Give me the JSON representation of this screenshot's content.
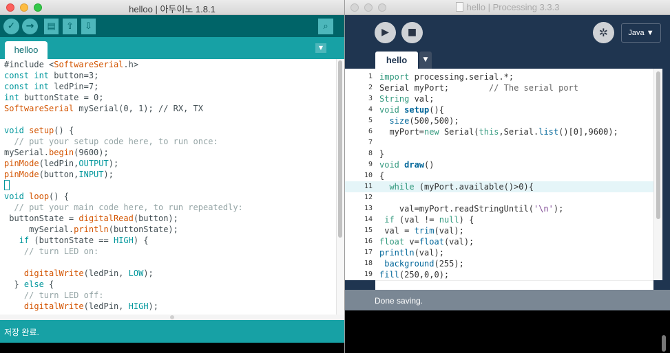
{
  "arduino": {
    "window_title": "helloo | 아두이노 1.8.1",
    "tab": "helloo",
    "status": "저장 완료.",
    "code": [
      [
        [
          "t",
          "#include <"
        ],
        [
          "fn",
          "SoftwareSerial"
        ],
        [
          "t",
          ".h>"
        ]
      ],
      [
        [
          "kw",
          "const"
        ],
        [
          "t",
          " "
        ],
        [
          "kw",
          "int"
        ],
        [
          "t",
          " button=3;"
        ]
      ],
      [
        [
          "kw",
          "const"
        ],
        [
          "t",
          " "
        ],
        [
          "kw",
          "int"
        ],
        [
          "t",
          " ledPin=7;"
        ]
      ],
      [
        [
          "kw",
          "int"
        ],
        [
          "t",
          " buttonState = 0;"
        ]
      ],
      [
        [
          "fn",
          "SoftwareSerial"
        ],
        [
          "t",
          " mySerial(0, 1); // RX, TX"
        ]
      ],
      [],
      [
        [
          "kw",
          "void"
        ],
        [
          "t",
          " "
        ],
        [
          "fn",
          "setup"
        ],
        [
          "t",
          "() {"
        ]
      ],
      [
        [
          "cm",
          "  // put your setup code here, to run once:"
        ]
      ],
      [
        [
          "t",
          "mySerial."
        ],
        [
          "fn",
          "begin"
        ],
        [
          "t",
          "(9600);"
        ]
      ],
      [
        [
          "fn",
          "pinMode"
        ],
        [
          "t",
          "(ledPin,"
        ],
        [
          "kw",
          "OUTPUT"
        ],
        [
          "t",
          ");"
        ]
      ],
      [
        [
          "fn",
          "pinMode"
        ],
        [
          "t",
          "(button,"
        ],
        [
          "kw",
          "INPUT"
        ],
        [
          "t",
          ");"
        ]
      ],
      [
        [
          "cursor",
          ""
        ]
      ],
      [
        [
          "kw",
          "void"
        ],
        [
          "t",
          " "
        ],
        [
          "fn",
          "loop"
        ],
        [
          "t",
          "() {"
        ]
      ],
      [
        [
          "cm",
          "  // put your main code here, to run repeatedly:"
        ]
      ],
      [
        [
          "t",
          " buttonState = "
        ],
        [
          "fn",
          "digitalRead"
        ],
        [
          "t",
          "(button);"
        ]
      ],
      [
        [
          "t",
          "     mySerial."
        ],
        [
          "fn",
          "println"
        ],
        [
          "t",
          "(buttonState);"
        ]
      ],
      [
        [
          "t",
          "   "
        ],
        [
          "kw",
          "if"
        ],
        [
          "t",
          " (buttonState == "
        ],
        [
          "kw",
          "HIGH"
        ],
        [
          "t",
          ") {"
        ]
      ],
      [
        [
          "cm",
          "    // turn LED on:"
        ]
      ],
      [],
      [
        [
          "t",
          "    "
        ],
        [
          "fn",
          "digitalWrite"
        ],
        [
          "t",
          "(ledPin, "
        ],
        [
          "kw",
          "LOW"
        ],
        [
          "t",
          ");"
        ]
      ],
      [
        [
          "t",
          "  } "
        ],
        [
          "kw",
          "else"
        ],
        [
          "t",
          " {"
        ]
      ],
      [
        [
          "cm",
          "    // turn LED off:"
        ]
      ],
      [
        [
          "t",
          "    "
        ],
        [
          "fn",
          "digitalWrite"
        ],
        [
          "t",
          "(ledPin, "
        ],
        [
          "kw",
          "HIGH"
        ],
        [
          "t",
          ");"
        ]
      ]
    ]
  },
  "processing": {
    "window_title": "hello | Processing 3.3.3",
    "mode": "Java ▼",
    "tab": "hello",
    "tab_menu": "▼",
    "status": "Done saving.",
    "highlighted_line": 11,
    "line_numbers": [
      "1",
      "2",
      "3",
      "4",
      "5",
      "6",
      "7",
      "8",
      "9",
      "10",
      "11",
      "12",
      "13",
      "14",
      "15",
      "16",
      "17",
      "18",
      "19"
    ],
    "code": [
      [
        [
          "kw",
          "import"
        ],
        [
          "t",
          " processing.serial.*;"
        ]
      ],
      [
        [
          "t",
          "Serial myPort;        "
        ],
        [
          "cm",
          "// The serial port"
        ]
      ],
      [
        [
          "kw",
          "String"
        ],
        [
          "t",
          " val;"
        ]
      ],
      [
        [
          "kw",
          "void"
        ],
        [
          "t",
          " "
        ],
        [
          "fnb",
          "setup"
        ],
        [
          "t",
          "(){"
        ]
      ],
      [
        [
          "t",
          "  "
        ],
        [
          "fn",
          "size"
        ],
        [
          "t",
          "(500,500);"
        ]
      ],
      [
        [
          "t",
          "  myPort="
        ],
        [
          "kw",
          "new"
        ],
        [
          "t",
          " Serial("
        ],
        [
          "kw",
          "this"
        ],
        [
          "t",
          ",Serial."
        ],
        [
          "fn",
          "list"
        ],
        [
          "t",
          "()[0],9600);"
        ]
      ],
      [],
      [
        [
          "t",
          "}"
        ]
      ],
      [
        [
          "kw",
          "void"
        ],
        [
          "t",
          " "
        ],
        [
          "fnb",
          "draw"
        ],
        [
          "t",
          "()"
        ]
      ],
      [
        [
          "t",
          "{"
        ]
      ],
      [
        [
          "t",
          "  "
        ],
        [
          "kw",
          "while"
        ],
        [
          "t",
          " (myPort.available()>0){"
        ]
      ],
      [],
      [
        [
          "t",
          "    val=myPort.readStringUntil("
        ],
        [
          "str",
          "'\\n'"
        ],
        [
          "t",
          ");"
        ]
      ],
      [
        [
          "t",
          " "
        ],
        [
          "kw",
          "if"
        ],
        [
          "t",
          " (val != "
        ],
        [
          "kw",
          "null"
        ],
        [
          "t",
          ") {"
        ]
      ],
      [
        [
          "t",
          " val = "
        ],
        [
          "fn",
          "trim"
        ],
        [
          "t",
          "(val);"
        ]
      ],
      [
        [
          "kw",
          "float"
        ],
        [
          "t",
          " v="
        ],
        [
          "fn",
          "float"
        ],
        [
          "t",
          "(val);"
        ]
      ],
      [
        [
          "fn",
          "println"
        ],
        [
          "t",
          "(val);"
        ]
      ],
      [
        [
          "t",
          " "
        ],
        [
          "fn",
          "background"
        ],
        [
          "t",
          "(255);"
        ]
      ],
      [
        [
          "fn",
          "fill"
        ],
        [
          "t",
          "(250,0,0);"
        ]
      ]
    ]
  },
  "icons": {
    "verify": "✓",
    "upload": "→",
    "new": "▤",
    "open": "⇧",
    "save": "⇩",
    "serial_monitor": "⌕",
    "tab_menu": "▼",
    "run": "▶",
    "stop": "■",
    "debug": "✲"
  },
  "colors": {
    "arduino_teal": "#006468",
    "arduino_bar": "#17a1a5",
    "arduino_button": "#4db7bb",
    "processing_bg": "#1f3550",
    "processing_status": "#7a8794",
    "line_highlight": "#e5f5f8"
  }
}
